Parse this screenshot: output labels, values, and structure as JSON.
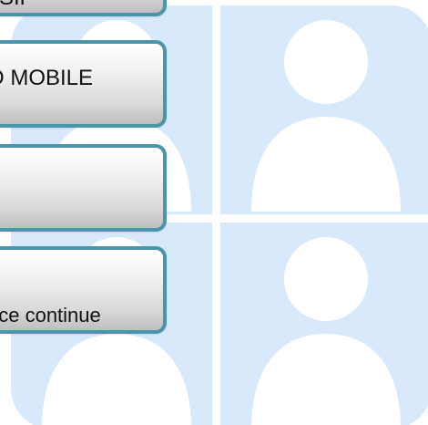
{
  "menu": {
    "items": [
      {
        "id": "sip",
        "label": "SIP"
      },
      {
        "id": "mobile",
        "label": "O MOBILE"
      },
      {
        "id": "blank",
        "label": ""
      },
      {
        "id": "continue",
        "label": "nce continue"
      }
    ]
  },
  "video_grid": {
    "participants": [
      {
        "icon": "person-icon"
      },
      {
        "icon": "person-icon"
      },
      {
        "icon": "person-icon"
      },
      {
        "icon": "person-icon"
      }
    ]
  },
  "colors": {
    "grid_background": "#d8e9fb",
    "grid_divider": "#ffffff",
    "menu_border": "#4a95aa",
    "avatar": "#ffffff"
  }
}
